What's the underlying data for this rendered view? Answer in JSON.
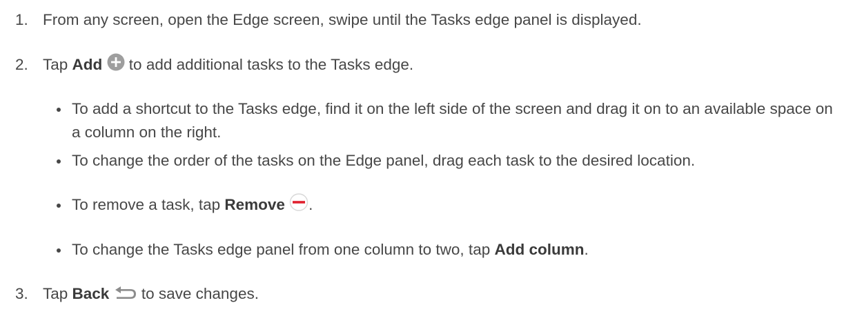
{
  "steps": [
    {
      "number": "1.",
      "text": "From any screen, open the Edge screen, swipe until the Tasks edge panel is displayed."
    },
    {
      "number": "2.",
      "prefix": "Tap ",
      "bold": "Add",
      "suffix": " to add additional tasks to the Tasks edge.",
      "icon": "add-plus-icon",
      "bullets": [
        {
          "text": "To add a shortcut to the Tasks edge, find it on the left side of the screen and drag it on to an available space on a column on the right."
        },
        {
          "text": "To change the order of the tasks on the Edge panel, drag each task to the desired location."
        },
        {
          "prefix": "To remove a task, tap ",
          "bold": "Remove",
          "suffix": ".",
          "icon": "remove-minus-icon"
        },
        {
          "prefix": "To change the Tasks edge panel from one column to two, tap ",
          "bold": "Add column",
          "suffix": "."
        }
      ]
    },
    {
      "number": "3.",
      "prefix": "Tap ",
      "bold": "Back",
      "suffix": " to save changes.",
      "icon": "back-arrow-icon"
    }
  ],
  "colors": {
    "text": "#474747",
    "add_icon": "#9e9e9e",
    "remove_icon": "#e0202e"
  }
}
